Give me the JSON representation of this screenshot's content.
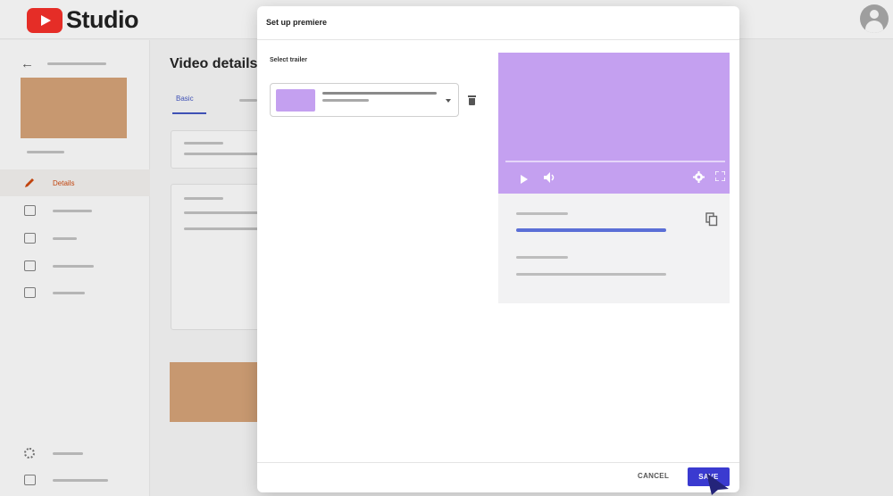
{
  "app": {
    "name": "Studio"
  },
  "sidebar": {
    "items": [
      {
        "label": "Details",
        "icon": "pencil-icon",
        "active": true
      }
    ]
  },
  "main": {
    "title": "Video details",
    "tabs": [
      {
        "label": "Basic",
        "active": true
      }
    ]
  },
  "modal": {
    "title": "Set up premiere",
    "select_label": "Select trailer",
    "cancel_label": "CANCEL",
    "save_label": "SAVE"
  },
  "colors": {
    "brand_red": "#e52d27",
    "accent_blue": "#3a3ad0",
    "active_orange": "#c1440e",
    "preview_purple": "#c4a0f0",
    "thumbnail_tan": "#c79870"
  }
}
